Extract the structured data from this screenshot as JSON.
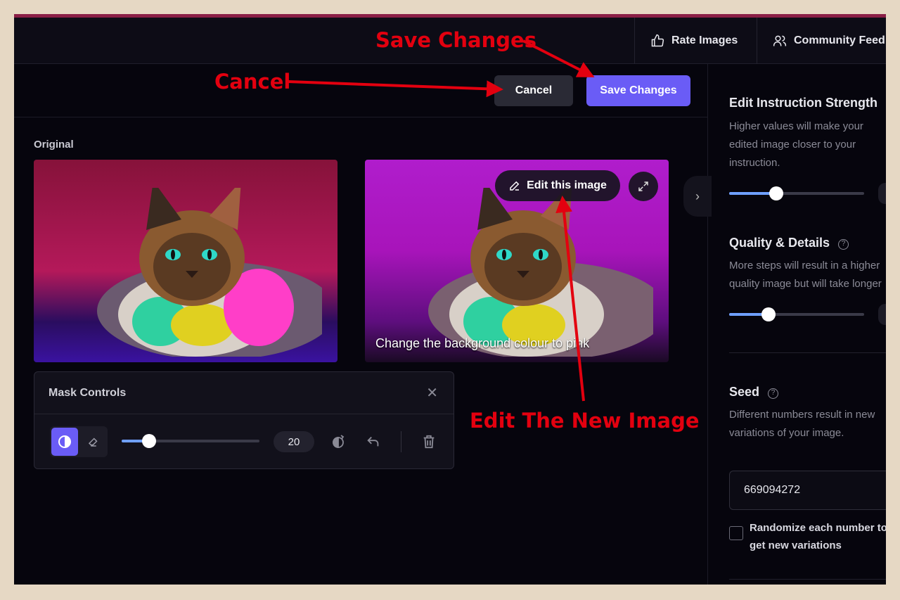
{
  "topbar": {
    "nav": [
      {
        "label": "Rate Images",
        "icon": "thumbs-up-icon"
      },
      {
        "label": "Community Feed",
        "icon": "users-icon"
      }
    ]
  },
  "toolbar": {
    "cancel_label": "Cancel",
    "save_label": "Save Changes"
  },
  "main": {
    "original_label": "Original",
    "edited_caption": "Change the background colour to pink",
    "edit_button_label": "Edit this image"
  },
  "mask_controls": {
    "title": "Mask Controls",
    "brush_size": "20",
    "brush_slider_fraction": 0.2
  },
  "settings": {
    "strength": {
      "title": "Edit Instruction Strength",
      "desc": "Higher values will make your\nedited image closer to your\ninstruction.",
      "slider_fraction": 0.35
    },
    "quality": {
      "title": "Quality & Details",
      "desc": "More steps will result in a higher\nquality image but will take longer",
      "slider_fraction": 0.29
    },
    "seed": {
      "title": "Seed",
      "desc": "Different numbers result in new\nvariations of your image.",
      "value": "669094272"
    },
    "randomize_label": "Randomize each number to\nget new variations"
  },
  "annotations": {
    "save": "Save Changes",
    "cancel": "Cancel",
    "edit": "Edit The New Image",
    "color": "#e3000f"
  },
  "colors": {
    "accent": "#6a5cf6",
    "slider": "#6fa0ff",
    "background": "#06050d"
  }
}
